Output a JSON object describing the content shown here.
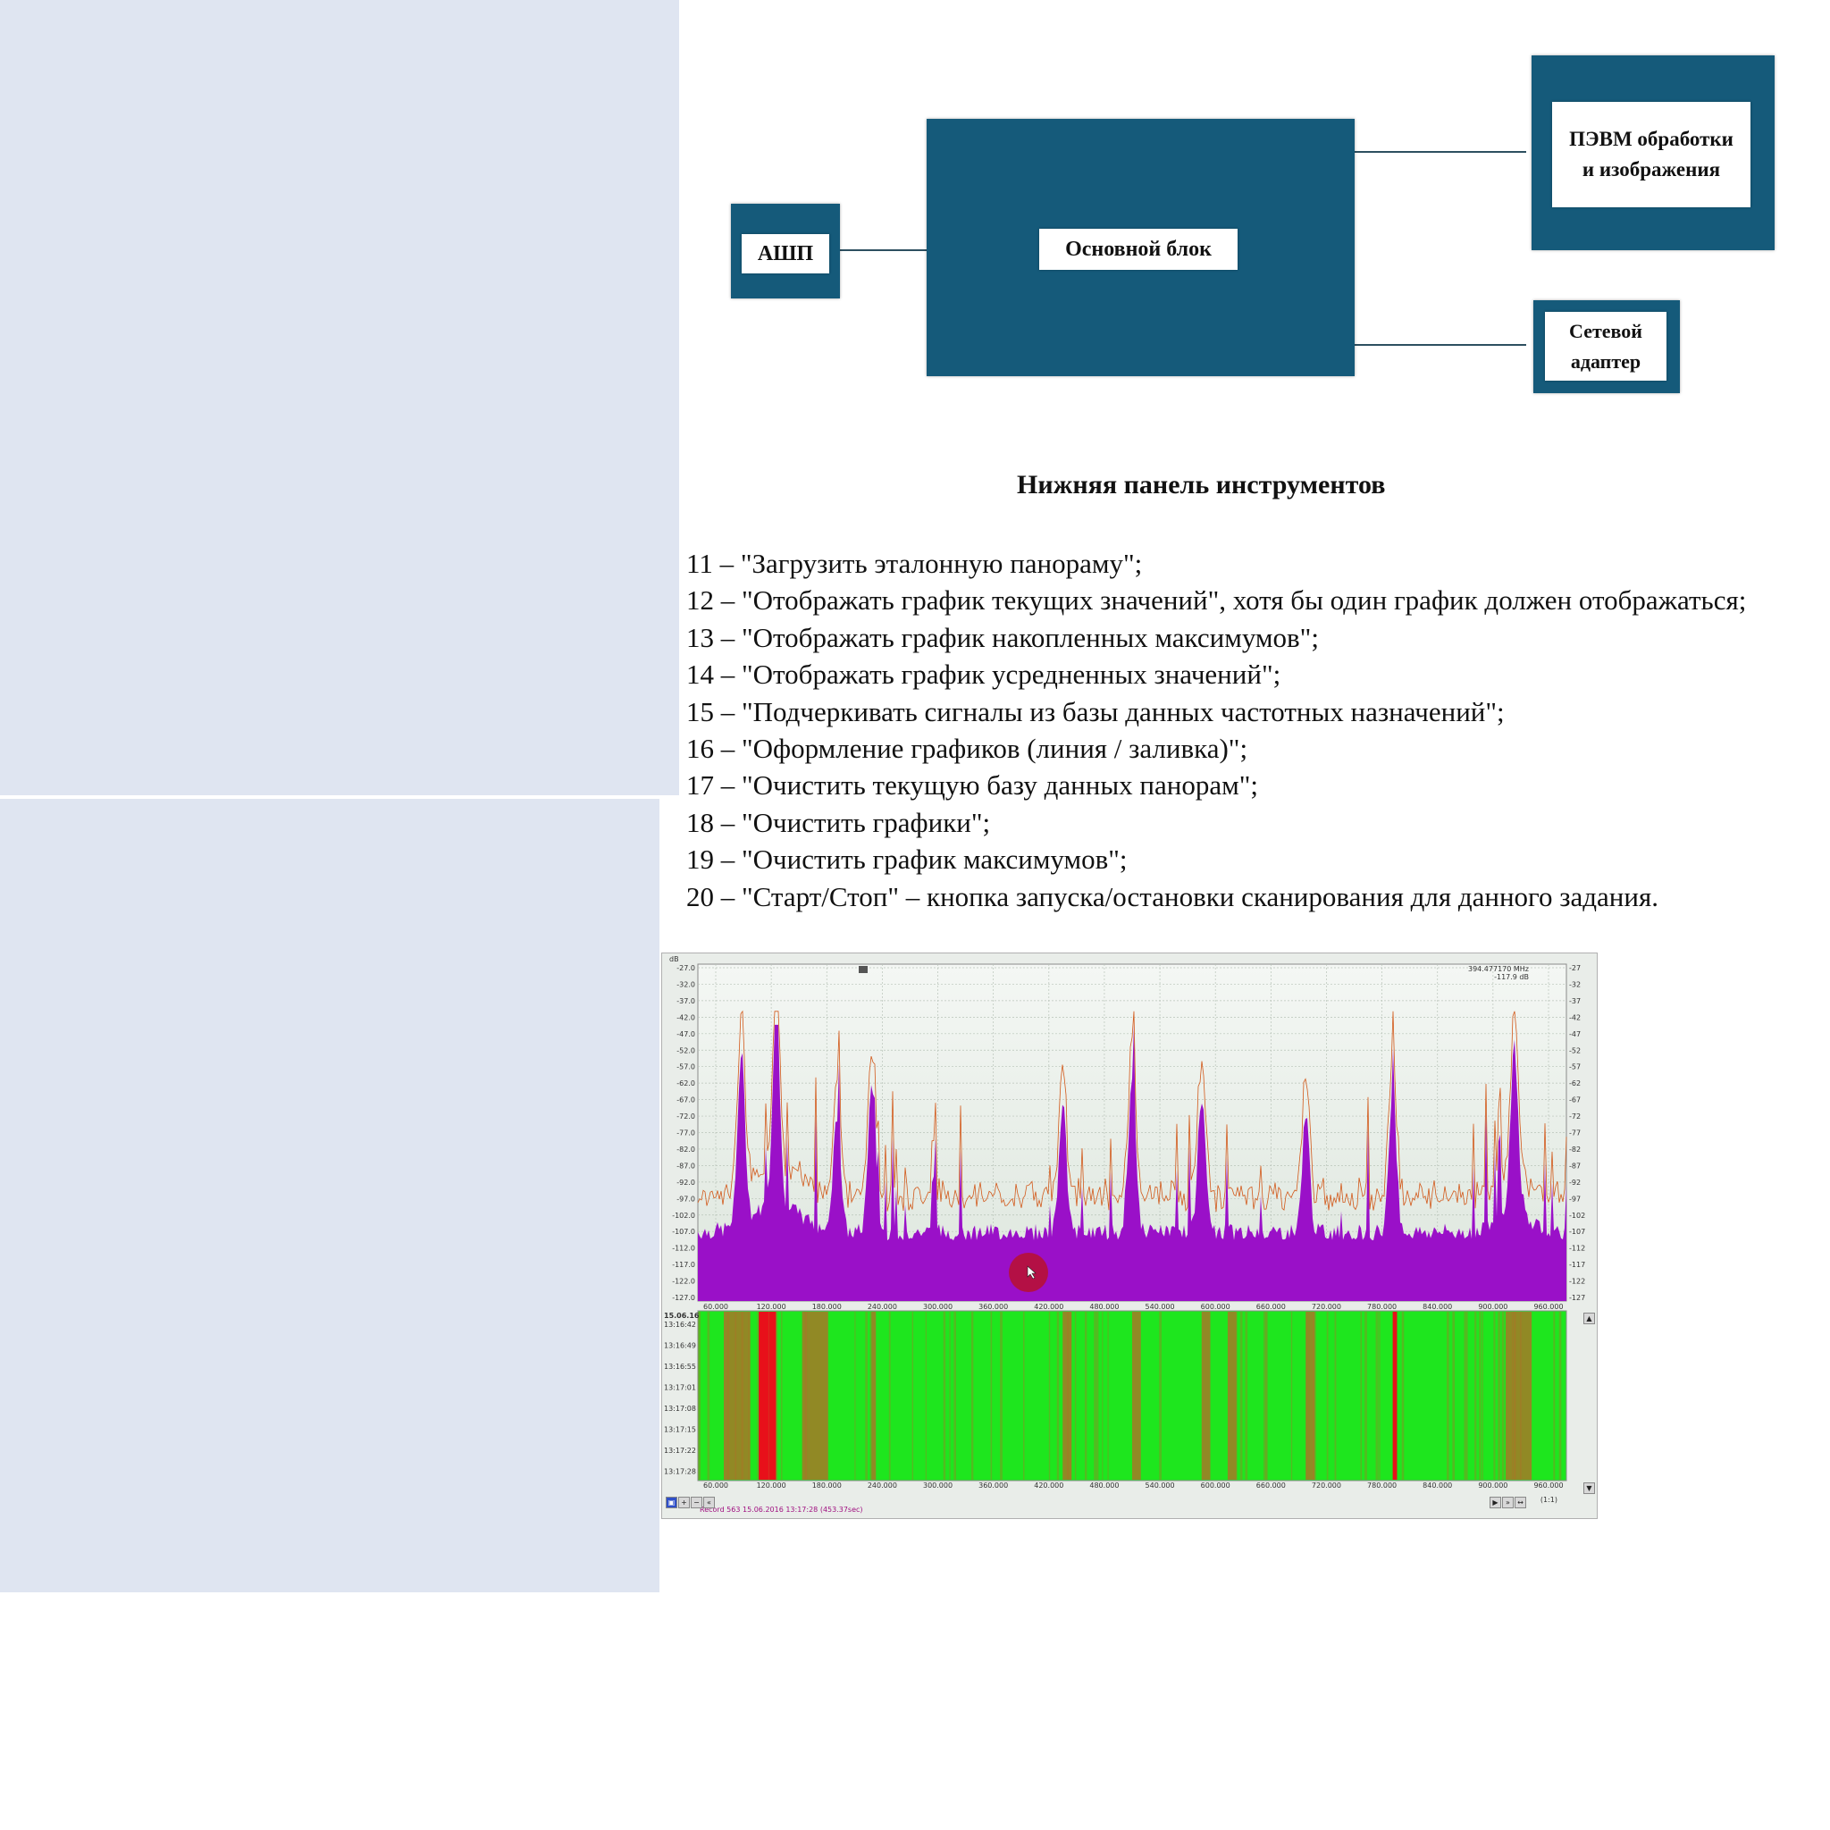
{
  "diagram": {
    "ash_label": "АШП",
    "main_label": "Основной блок",
    "pc_label": "ПЭВМ обработки и изображения",
    "net_label": "Сетевой адаптер"
  },
  "heading": "Нижняя панель инструментов",
  "items": [
    "11 – \"Загрузить эталонную панораму\";",
    "12 – \"Отображать график текущих значений\", хотя бы один график должен отображаться;",
    "13 – \"Отображать график накопленных максимумов\";",
    "14 – \"Отображать график усредненных значений\";",
    "15 – \"Подчеркивать сигналы из базы данных частотных назначений\";",
    "16 – \"Оформление графиков (линия / заливка)\";",
    "17 – \"Очистить текущую базу данных панорам\";",
    "18 – \"Очистить графики\";",
    "19 – \"Очистить график максимумов\";",
    "20 – \"Старт/Стоп\" – кнопка запуска/остановки сканирования для данного задания."
  ],
  "screenshot": {
    "unit_label": "dB",
    "y_ticks": [
      "-27.0",
      "-32.0",
      "-37.0",
      "-42.0",
      "-47.0",
      "-52.0",
      "-57.0",
      "-62.0",
      "-67.0",
      "-72.0",
      "-77.0",
      "-82.0",
      "-87.0",
      "-92.0",
      "-97.0",
      "-102.0",
      "-107.0",
      "-112.0",
      "-117.0",
      "-122.0",
      "-127.0"
    ],
    "x_ticks": [
      "60.000",
      "120.000",
      "180.000",
      "240.000",
      "300.000",
      "360.000",
      "420.000",
      "480.000",
      "540.000",
      "600.000",
      "660.000",
      "720.000",
      "780.000",
      "840.000",
      "900.000",
      "960.000"
    ],
    "readout_freq": "394.477170 MHz",
    "readout_level": "-117.9 dB",
    "waterfall_date": "15.06.16",
    "waterfall_times": [
      "13:16:42",
      "13:16:49",
      "13:16:55",
      "13:17:01",
      "13:17:08",
      "13:17:15",
      "13:17:22",
      "13:17:28"
    ],
    "status": "Record 563 15.06.2016 13:17:28 (453.37sec)",
    "zoom": "(1:1)",
    "colors": {
      "fill": "#9a10c8",
      "max_line": "#d2591a",
      "waterfall_bg": "#1ee61e",
      "waterfall_hot": "#e8101a",
      "waterfall_warm": "#b86a28"
    }
  }
}
